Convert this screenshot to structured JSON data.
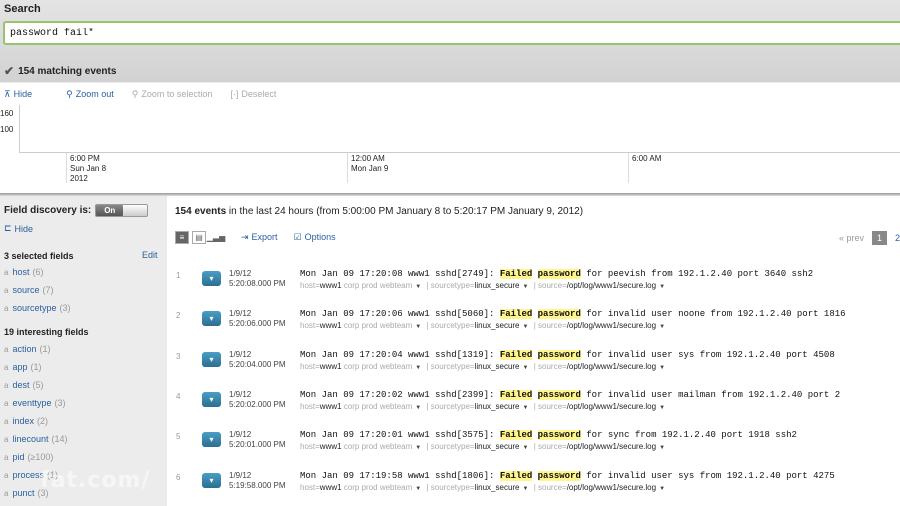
{
  "search": {
    "label": "Search",
    "query": "password fail*",
    "matching": "154 matching events"
  },
  "timeline": {
    "actions": [
      {
        "label": "Hide",
        "icon": "hide-icon",
        "enabled": true
      },
      {
        "label": "Zoom out",
        "icon": "zoom-out-icon",
        "enabled": true
      },
      {
        "label": "Zoom to selection",
        "icon": "zoom-in-icon",
        "enabled": false
      },
      {
        "label": "Deselect",
        "icon": "deselect-icon",
        "enabled": false
      }
    ],
    "y_ticks": [
      "160",
      "100"
    ],
    "x_ticks": [
      {
        "line1": "6:00 PM",
        "line2": "Sun Jan 8",
        "line3": "2012"
      },
      {
        "line1": "12:00 AM",
        "line2": "Mon Jan 9",
        "line3": ""
      },
      {
        "line1": "6:00 AM",
        "line2": "",
        "line3": ""
      }
    ]
  },
  "sidebar": {
    "field_discovery_label": "Field discovery is:",
    "toggle_on": "On",
    "hide_label": "Hide",
    "selected_header": "3 selected fields",
    "edit_label": "Edit",
    "selected_fields": [
      {
        "name": "host",
        "count": "(6)"
      },
      {
        "name": "source",
        "count": "(7)"
      },
      {
        "name": "sourcetype",
        "count": "(3)"
      }
    ],
    "interesting_header": "19 interesting fields",
    "interesting_fields": [
      {
        "name": "action",
        "count": "(1)"
      },
      {
        "name": "app",
        "count": "(1)"
      },
      {
        "name": "dest",
        "count": "(5)"
      },
      {
        "name": "eventtype",
        "count": "(3)"
      },
      {
        "name": "index",
        "count": "(2)"
      },
      {
        "name": "linecount",
        "count": "(14)"
      },
      {
        "name": "pid",
        "count": "(≥100)"
      },
      {
        "name": "process",
        "count": "(1)"
      },
      {
        "name": "punct",
        "count": "(3)"
      }
    ]
  },
  "events": {
    "summary_count": "154 events",
    "summary_rest": " in the last 24 hours (from 5:00:00 PM January 8 to 5:20:17 PM January 9, 2012)",
    "export_label": "Export",
    "options_label": "Options",
    "prev_label": "« prev",
    "current_page": "1",
    "next_page": "2",
    "meta_labels": {
      "host": "host=",
      "sourcetype": "sourcetype=",
      "source": "source="
    },
    "items": [
      {
        "num": "1",
        "date": "1/9/12",
        "time": "5:20:08.000 PM",
        "pre": "Mon Jan 09 17:20:08 www1 sshd[2749]: ",
        "w1": "Failed",
        "w2": "password",
        "post": " for peevish from 192.1.2.40 port 3640 ssh2",
        "host": "www1",
        "tag": "corp prod webteam",
        "sourcetype": "linux_secure",
        "source": "/opt/log/www1/secure.log"
      },
      {
        "num": "2",
        "date": "1/9/12",
        "time": "5:20:06.000 PM",
        "pre": "Mon Jan 09 17:20:06 www1 sshd[5060]: ",
        "w1": "Failed",
        "w2": "password",
        "post": " for invalid user noone from 192.1.2.40 port 1816",
        "host": "www1",
        "tag": "corp prod webteam",
        "sourcetype": "linux_secure",
        "source": "/opt/log/www1/secure.log"
      },
      {
        "num": "3",
        "date": "1/9/12",
        "time": "5:20:04.000 PM",
        "pre": "Mon Jan 09 17:20:04 www1 sshd[1319]: ",
        "w1": "Failed",
        "w2": "password",
        "post": " for invalid user sys from 192.1.2.40 port 4508",
        "host": "www1",
        "tag": "corp prod webteam",
        "sourcetype": "linux_secure",
        "source": "/opt/log/www1/secure.log"
      },
      {
        "num": "4",
        "date": "1/9/12",
        "time": "5:20:02.000 PM",
        "pre": "Mon Jan 09 17:20:02 www1 sshd[2399]: ",
        "w1": "Failed",
        "w2": "password",
        "post": " for invalid user mailman from 192.1.2.40 port 2",
        "host": "www1",
        "tag": "corp prod webteam",
        "sourcetype": "linux_secure",
        "source": "/opt/log/www1/secure.log"
      },
      {
        "num": "5",
        "date": "1/9/12",
        "time": "5:20:01.000 PM",
        "pre": "Mon Jan 09 17:20:01 www1 sshd[3575]: ",
        "w1": "Failed",
        "w2": "password",
        "post": " for sync from 192.1.2.40 port 1918 ssh2",
        "host": "www1",
        "tag": "corp prod webteam",
        "sourcetype": "linux_secure",
        "source": "/opt/log/www1/secure.log"
      },
      {
        "num": "6",
        "date": "1/9/12",
        "time": "5:19:58.000 PM",
        "pre": "Mon Jan 09 17:19:58 www1 sshd[1806]: ",
        "w1": "Failed",
        "w2": "password",
        "post": " for invalid user sys from 192.1.2.40 port 4275",
        "host": "www1",
        "tag": "corp prod webteam",
        "sourcetype": "linux_secure",
        "source": "/opt/log/www1/secure.log"
      }
    ]
  },
  "watermark": "fat.com/"
}
